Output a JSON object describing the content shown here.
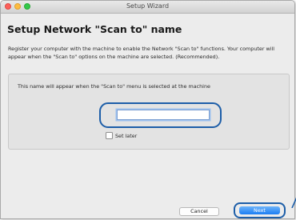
{
  "window": {
    "title": "Setup Wizard"
  },
  "page": {
    "title": "Setup Network \"Scan to\" name",
    "intro": "Register your computer with the machine to enable the Network \"Scan to\" functions. Your computer will appear when the \"Scan to\" options on the machine are selected. (Recommended)."
  },
  "panel": {
    "description": "This name will appear when the \"Scan to\" menu is selected at the machine",
    "name_field_value": "",
    "set_later_label": "Set later",
    "set_later_checked": false
  },
  "buttons": {
    "cancel_label": "Cancel",
    "next_label": "Next"
  },
  "colors": {
    "highlight": "#1d5ea8",
    "primary_button": "#1b7ef4",
    "window_bg": "#ececec"
  }
}
